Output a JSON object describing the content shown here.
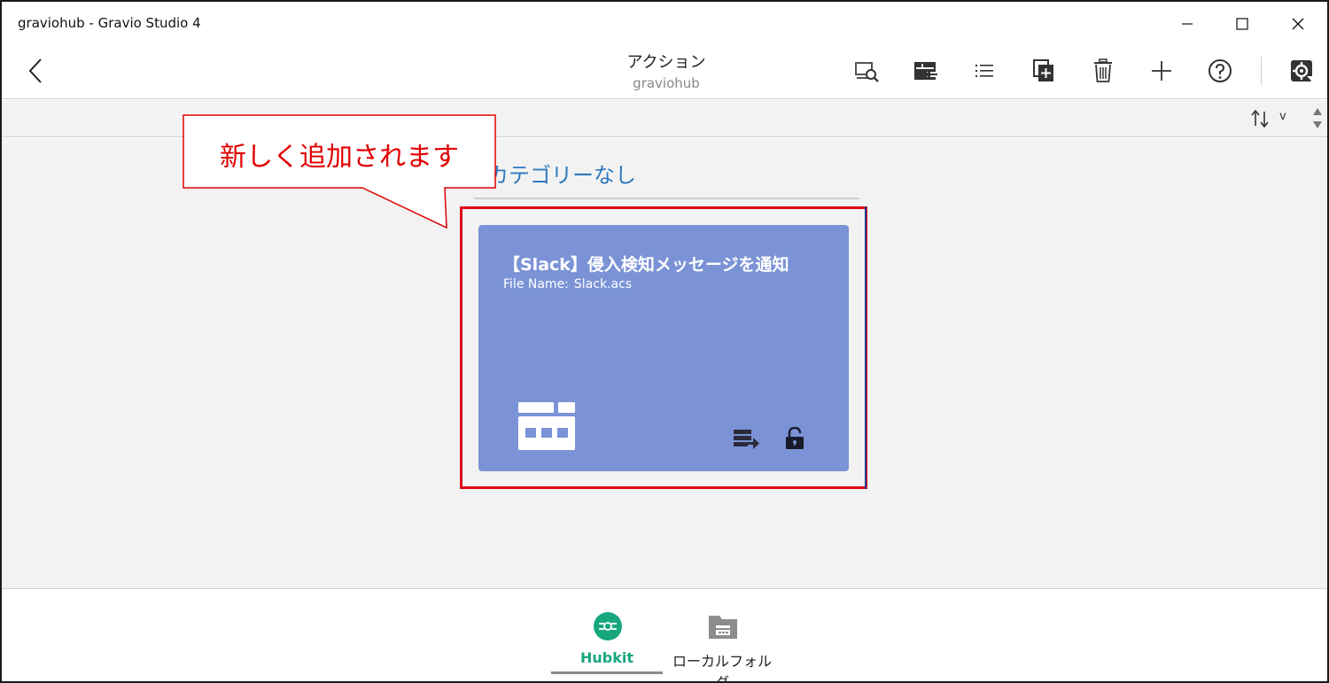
{
  "window": {
    "title": "graviohub - Gravio Studio 4"
  },
  "header": {
    "title": "アクション",
    "subtitle": "graviohub"
  },
  "toolbar": {
    "icons": [
      "search-monitor-icon",
      "import-icon",
      "list-icon",
      "duplicate-icon",
      "trash-icon",
      "plus-icon",
      "help-icon",
      "settings-refresh-icon"
    ]
  },
  "sortbar": {
    "dropdown_label": "v"
  },
  "category": {
    "title": "カテゴリーなし"
  },
  "card": {
    "title": "【Slack】侵入検知メッセージを通知",
    "file_label": "File Name:",
    "file_name": "Slack.acs",
    "color": "#7b93d6"
  },
  "callout": {
    "text": "新しく追加されます",
    "color": "#e00000"
  },
  "bottom_nav": {
    "items": [
      {
        "label": "Hubkit",
        "active": true
      },
      {
        "label": "ローカルフォルダ",
        "active": false
      }
    ],
    "active_color": "#17a77e"
  }
}
